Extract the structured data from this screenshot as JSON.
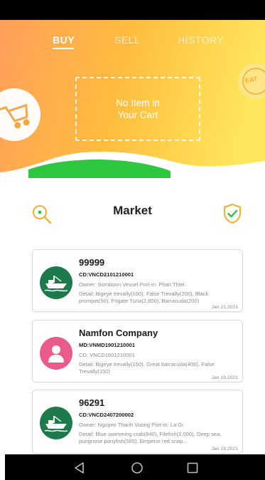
{
  "tabs": [
    {
      "label": "BUY",
      "active": true
    },
    {
      "label": "SELL",
      "active": false
    },
    {
      "label": "HISTORY",
      "active": false
    }
  ],
  "cart": {
    "line1": "No Item in",
    "line2": "Your Cart"
  },
  "side_badge": "EAT",
  "market": {
    "title": "Market"
  },
  "colors": {
    "gradient_start": "#ffa05a",
    "gradient_mid": "#ffbf3f",
    "gradient_end": "#ffe95a",
    "green": "#2ec840",
    "avatar_green": "#1c7a4b",
    "avatar_pink": "#ea5b8a",
    "icon_gold": "#f2b02a"
  },
  "cards": [
    {
      "title": "99999",
      "code": "CD:VNCD2101210001",
      "owner": "Owner: Somboon Vessel  Port-in: Phan Thiet",
      "detail": "Detail: Bigeye trevally(100), False Trevally(200), Black prompet(50), Frigate Tuna(2,800), Barracuda(200)",
      "date": "Jan 21,2021",
      "avatar": "ship-icon"
    },
    {
      "title": "Namfon Company",
      "code": "MD:VNMD1901210001",
      "owner": "CD: VNCD1601210001",
      "detail": "Detail: Bigeye trevally(150), Great barracuda(400), False Trevally(150)",
      "date": "Jan 19,2021",
      "avatar": "person-icon"
    },
    {
      "title": "96291",
      "code": "CD:VNCD2407200002",
      "owner": "Owner: Nguyen Thanh Vuong  Port-in: La Gi",
      "detail": "Detail: Blue swimming crab(840), Filefish(2,000), Deep sea pungnose ponyfish(565), Emperor red snap...",
      "date": "Jan 18,2021",
      "avatar": "ship-icon"
    }
  ]
}
